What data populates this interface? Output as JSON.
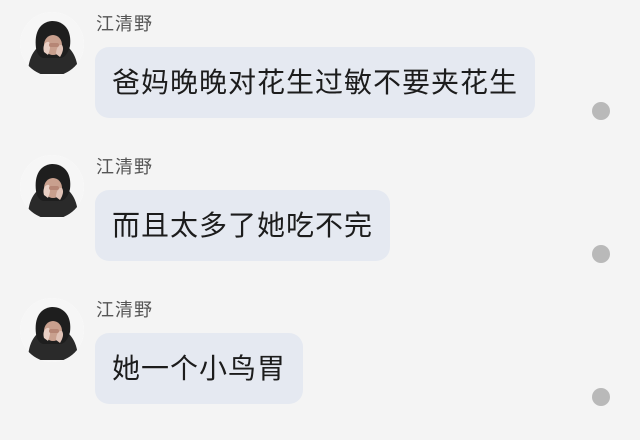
{
  "messages": [
    {
      "sender": "江清野",
      "text": "爸妈晚晚对花生过敏不要夹花生"
    },
    {
      "sender": "江清野",
      "text": "而且太多了她吃不完"
    },
    {
      "sender": "江清野",
      "text": "她一个小鸟胃"
    }
  ],
  "colors": {
    "background": "#f4f4f4",
    "bubble": "#e5e9f1",
    "sender_text": "#555555",
    "message_text": "#1c1c1c",
    "status_dot": "#b9b9b9"
  }
}
